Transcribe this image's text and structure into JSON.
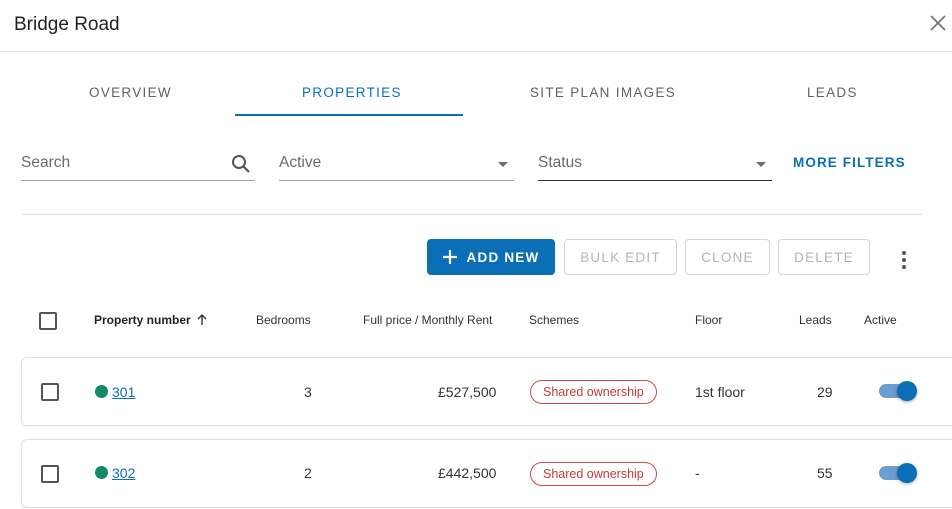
{
  "header": {
    "title": "Bridge Road"
  },
  "tabs": [
    {
      "label": "OVERVIEW",
      "active": false
    },
    {
      "label": "PROPERTIES",
      "active": true
    },
    {
      "label": "SITE PLAN IMAGES",
      "active": false
    },
    {
      "label": "LEADS",
      "active": false
    }
  ],
  "filters": {
    "search_placeholder": "Search",
    "active_value": "Active",
    "status_placeholder": "Status",
    "more_filters_label": "MORE FILTERS"
  },
  "toolbar": {
    "add_new_label": "ADD NEW",
    "bulk_edit_label": "BULK EDIT",
    "clone_label": "CLONE",
    "delete_label": "DELETE"
  },
  "table": {
    "columns": [
      "Property number",
      "Bedrooms",
      "Full price / Monthly Rent",
      "Schemes",
      "Floor",
      "Leads",
      "Active"
    ],
    "rows": [
      {
        "property_number": "301",
        "bedrooms": "3",
        "price": "£527,500",
        "scheme": "Shared ownership",
        "floor": "1st floor",
        "leads": "29",
        "active": true
      },
      {
        "property_number": "302",
        "bedrooms": "2",
        "price": "£442,500",
        "scheme": "Shared ownership",
        "floor": "-",
        "leads": "55",
        "active": true
      }
    ]
  },
  "colors": {
    "accent": "#0b6fb8",
    "status_dot": "#138a6a",
    "badge_red": "#c43a3a"
  }
}
